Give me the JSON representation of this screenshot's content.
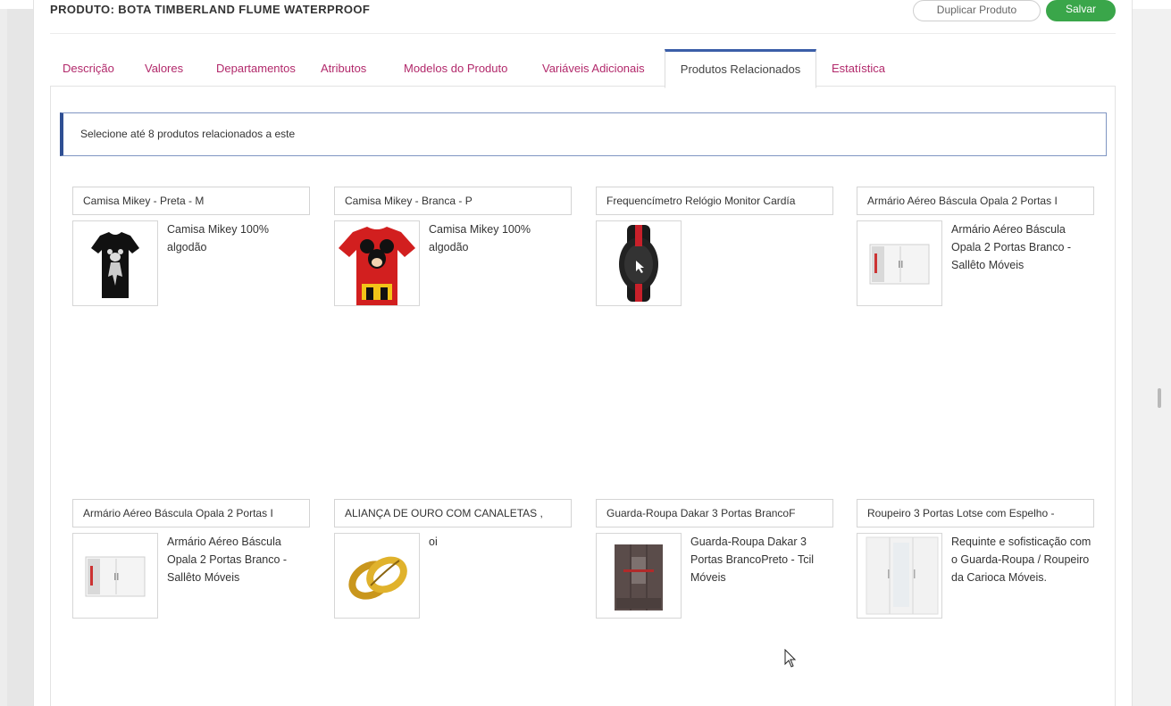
{
  "header": {
    "product_title": "PRODUTO: BOTA TIMBERLAND FLUME WATERPROOF",
    "duplicate_button": "Duplicar Produto",
    "save_button": "Salvar"
  },
  "tabs": [
    {
      "label": "Descrição"
    },
    {
      "label": "Valores"
    },
    {
      "label": "Departamentos"
    },
    {
      "label": "Atributos"
    },
    {
      "label": "Modelos do Produto"
    },
    {
      "label": "Variáveis Adicionais"
    },
    {
      "label": "Produtos Relacionados",
      "active": true
    },
    {
      "label": "Estatística"
    }
  ],
  "info_message": "Selecione até 8 produtos relacionados a este",
  "related_products": [
    {
      "select_value": "Camisa Mikey - Preta - M",
      "description": "Camisa Mikey 100% algodão",
      "thumb_icon": "black-mickey-shirt-image"
    },
    {
      "select_value": "Camisa Mikey - Branca - P",
      "description": "Camisa Mikey 100% algodão",
      "thumb_icon": "red-mickey-shirt-image"
    },
    {
      "select_value": "Frequencímetro Relógio Monitor Cardía",
      "description": "",
      "thumb_icon": "heart-rate-watch-image"
    },
    {
      "select_value": "Armário Aéreo Báscula Opala 2 Portas I",
      "description": "Armário Aéreo Báscula Opala 2 Portas Branco - Sallêto Móveis",
      "thumb_icon": "white-cabinet-image"
    },
    {
      "select_value": "Armário Aéreo Báscula Opala 2 Portas I",
      "description": "Armário Aéreo Báscula Opala 2 Portas Branco - Sallêto Móveis",
      "thumb_icon": "white-cabinet-image"
    },
    {
      "select_value": "ALIANÇA DE OURO COM CANALETAS ,",
      "description": "oi",
      "thumb_icon": "gold-rings-image"
    },
    {
      "select_value": "Guarda-Roupa Dakar 3 Portas BrancoF",
      "description": "Guarda-Roupa Dakar 3 Portas BrancoPreto - Tcil Móveis",
      "thumb_icon": "wardrobe-image"
    },
    {
      "select_value": "Roupeiro 3 Portas Lotse com Espelho -",
      "description": "Requinte e sofisticação com o Guarda-Roupa / Roupeiro da Carioca Móveis.",
      "thumb_icon": "white-wardrobe-image"
    }
  ]
}
